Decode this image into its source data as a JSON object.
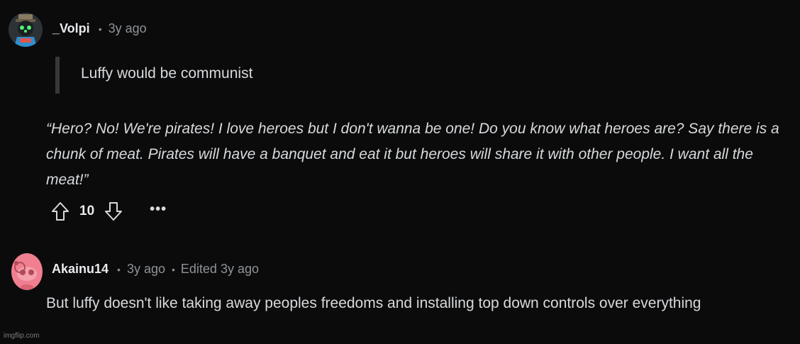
{
  "comments": [
    {
      "username": "_Volpi",
      "time": "3y ago",
      "quote": "Luffy would be communist",
      "body": "“Hero? No! We're pirates! I love heroes but I don't wanna be one! Do you know what heroes are? Say there is a chunk of meat. Pirates will have a banquet and eat it but heroes will share it with other people. I want all the meat!”",
      "score": "10",
      "more_label": "•••",
      "avatar_icon": "robot-avatar-icon"
    },
    {
      "username": "Akainu14",
      "time": "3y ago",
      "edited": "Edited 3y ago",
      "body": "But luffy doesn't like taking away peoples freedoms and installing top down controls over everything",
      "avatar_icon": "snoo-avatar-icon"
    }
  ],
  "watermark": "imgflip.com",
  "colors": {
    "background": "#0b0b0c",
    "text": "#d7dadc",
    "muted": "#8f9397",
    "avatar_pink": "#f07f8f"
  }
}
